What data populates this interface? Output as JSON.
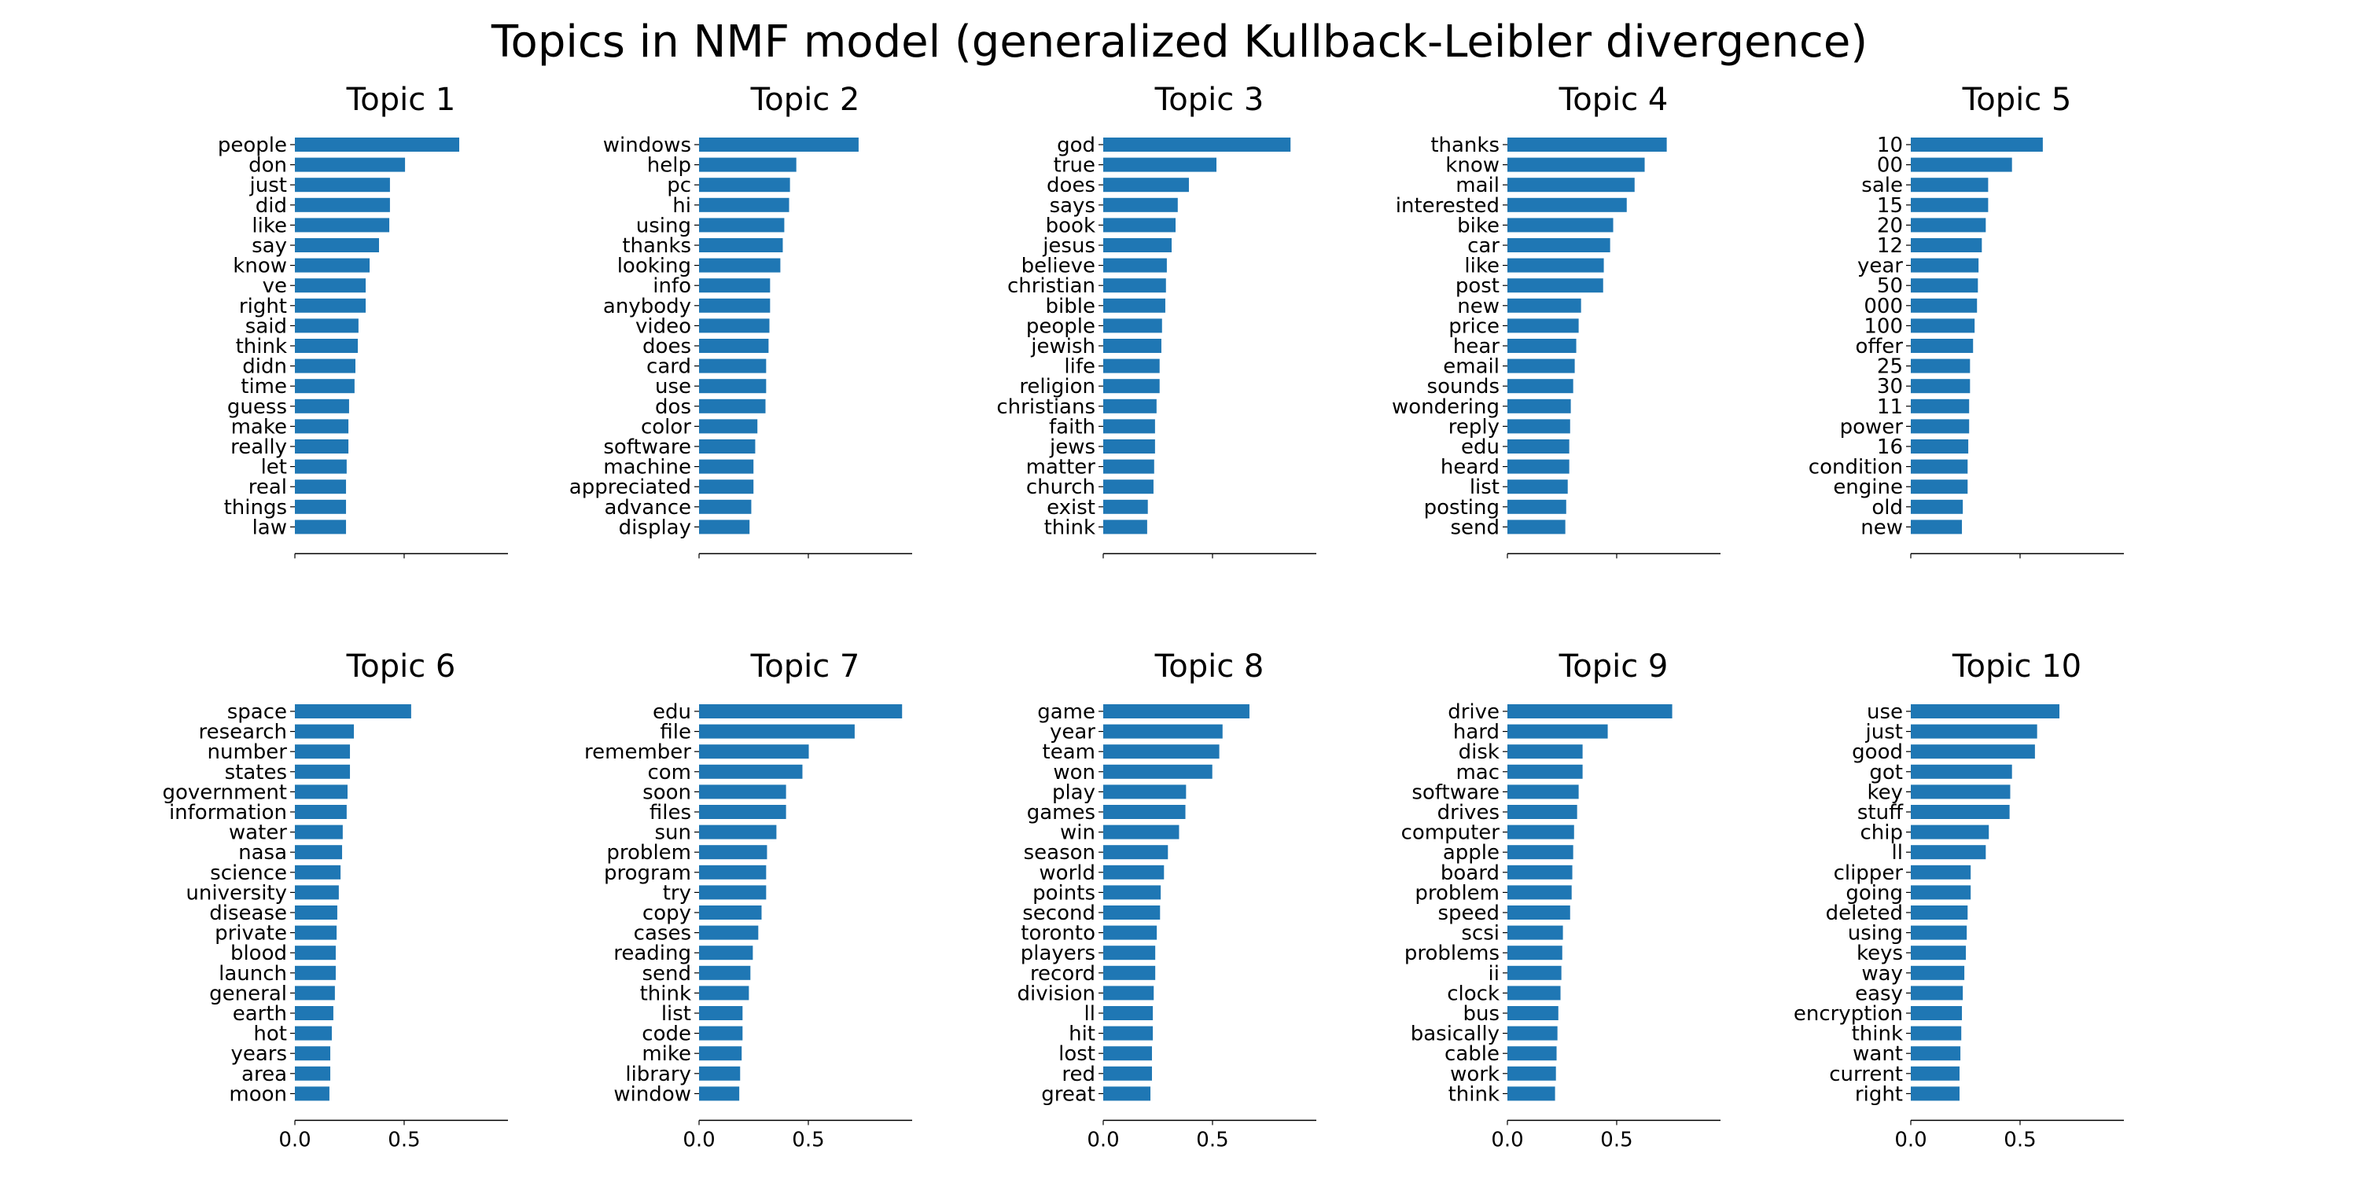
{
  "chart_data": {
    "type": "bar",
    "orientation": "horizontal",
    "title": "Topics in NMF model (generalized Kullback-Leibler divergence)",
    "bar_color": "#1f77b4",
    "xlim": [
      0,
      0.975
    ],
    "xticks": [
      "0.0",
      "0.5"
    ],
    "xtick_values": [
      0,
      0.5
    ],
    "xtick_labels_visible_on": "bottom-row",
    "grid": false,
    "panels": [
      {
        "title": "Topic 1",
        "categories": [
          "people",
          "don",
          "just",
          "did",
          "like",
          "say",
          "know",
          "ve",
          "right",
          "said",
          "think",
          "didn",
          "time",
          "guess",
          "make",
          "really",
          "let",
          "real",
          "things",
          "law"
        ],
        "values": [
          0.752,
          0.504,
          0.435,
          0.435,
          0.432,
          0.385,
          0.342,
          0.324,
          0.324,
          0.291,
          0.288,
          0.277,
          0.273,
          0.248,
          0.245,
          0.245,
          0.237,
          0.234,
          0.234,
          0.234
        ]
      },
      {
        "title": "Topic 2",
        "categories": [
          "windows",
          "help",
          "pc",
          "hi",
          "using",
          "thanks",
          "looking",
          "info",
          "anybody",
          "video",
          "does",
          "card",
          "use",
          "dos",
          "color",
          "software",
          "machine",
          "appreciated",
          "advance",
          "display"
        ],
        "values": [
          0.73,
          0.445,
          0.416,
          0.412,
          0.39,
          0.383,
          0.372,
          0.325,
          0.325,
          0.322,
          0.318,
          0.307,
          0.307,
          0.304,
          0.267,
          0.257,
          0.249,
          0.249,
          0.239,
          0.231
        ]
      },
      {
        "title": "Topic 3",
        "categories": [
          "god",
          "true",
          "does",
          "says",
          "book",
          "jesus",
          "believe",
          "christian",
          "bible",
          "people",
          "jewish",
          "life",
          "religion",
          "christians",
          "faith",
          "jews",
          "matter",
          "church",
          "exist",
          "think"
        ],
        "values": [
          0.857,
          0.518,
          0.392,
          0.341,
          0.331,
          0.313,
          0.291,
          0.287,
          0.284,
          0.269,
          0.266,
          0.258,
          0.258,
          0.244,
          0.237,
          0.237,
          0.233,
          0.23,
          0.204,
          0.201
        ]
      },
      {
        "title": "Topic 4",
        "categories": [
          "thanks",
          "know",
          "mail",
          "interested",
          "bike",
          "car",
          "like",
          "post",
          "new",
          "price",
          "hear",
          "email",
          "sounds",
          "wondering",
          "reply",
          "edu",
          "heard",
          "list",
          "posting",
          "send"
        ],
        "values": [
          0.729,
          0.628,
          0.582,
          0.546,
          0.484,
          0.47,
          0.441,
          0.438,
          0.337,
          0.326,
          0.315,
          0.308,
          0.301,
          0.29,
          0.287,
          0.283,
          0.283,
          0.276,
          0.269,
          0.265
        ]
      },
      {
        "title": "Topic 5",
        "categories": [
          "10",
          "00",
          "sale",
          "15",
          "20",
          "12",
          "year",
          "50",
          "000",
          "100",
          "offer",
          "25",
          "30",
          "11",
          "power",
          "16",
          "condition",
          "engine",
          "old",
          "new"
        ],
        "values": [
          0.604,
          0.463,
          0.354,
          0.354,
          0.343,
          0.325,
          0.31,
          0.307,
          0.303,
          0.292,
          0.285,
          0.271,
          0.271,
          0.267,
          0.267,
          0.263,
          0.26,
          0.26,
          0.238,
          0.234
        ]
      },
      {
        "title": "Topic 6",
        "categories": [
          "space",
          "research",
          "number",
          "states",
          "government",
          "information",
          "water",
          "nasa",
          "science",
          "university",
          "disease",
          "private",
          "blood",
          "launch",
          "general",
          "earth",
          "hot",
          "years",
          "area",
          "moon"
        ],
        "values": [
          0.532,
          0.27,
          0.252,
          0.252,
          0.241,
          0.237,
          0.219,
          0.216,
          0.209,
          0.201,
          0.194,
          0.191,
          0.187,
          0.187,
          0.183,
          0.176,
          0.169,
          0.162,
          0.162,
          0.158
        ]
      },
      {
        "title": "Topic 7",
        "categories": [
          "edu",
          "file",
          "remember",
          "com",
          "soon",
          "files",
          "sun",
          "problem",
          "program",
          "try",
          "copy",
          "cases",
          "reading",
          "send",
          "think",
          "list",
          "code",
          "mike",
          "library",
          "window"
        ],
        "values": [
          0.929,
          0.712,
          0.502,
          0.473,
          0.398,
          0.398,
          0.354,
          0.311,
          0.307,
          0.307,
          0.286,
          0.271,
          0.246,
          0.235,
          0.228,
          0.199,
          0.199,
          0.195,
          0.188,
          0.184
        ]
      },
      {
        "title": "Topic 8",
        "categories": [
          "game",
          "year",
          "team",
          "won",
          "play",
          "games",
          "win",
          "season",
          "world",
          "points",
          "second",
          "toronto",
          "players",
          "record",
          "division",
          "ll",
          "hit",
          "lost",
          "red",
          "great"
        ],
        "values": [
          0.669,
          0.546,
          0.531,
          0.499,
          0.379,
          0.376,
          0.347,
          0.296,
          0.278,
          0.263,
          0.26,
          0.245,
          0.238,
          0.238,
          0.231,
          0.227,
          0.227,
          0.223,
          0.223,
          0.216
        ]
      },
      {
        "title": "Topic 9",
        "categories": [
          "drive",
          "hard",
          "disk",
          "mac",
          "software",
          "drives",
          "computer",
          "apple",
          "board",
          "problem",
          "speed",
          "scsi",
          "problems",
          "ii",
          "clock",
          "bus",
          "basically",
          "cable",
          "work",
          "think"
        ],
        "values": [
          0.754,
          0.459,
          0.344,
          0.344,
          0.326,
          0.319,
          0.305,
          0.301,
          0.297,
          0.294,
          0.287,
          0.254,
          0.251,
          0.247,
          0.243,
          0.233,
          0.229,
          0.225,
          0.222,
          0.218
        ]
      },
      {
        "title": "Topic 10",
        "categories": [
          "use",
          "just",
          "good",
          "got",
          "key",
          "stuff",
          "chip",
          "ll",
          "clipper",
          "going",
          "deleted",
          "using",
          "keys",
          "way",
          "easy",
          "encryption",
          "think",
          "want",
          "current",
          "right"
        ],
        "values": [
          0.68,
          0.578,
          0.568,
          0.463,
          0.455,
          0.452,
          0.357,
          0.343,
          0.274,
          0.274,
          0.26,
          0.256,
          0.252,
          0.245,
          0.238,
          0.234,
          0.231,
          0.227,
          0.223,
          0.223
        ]
      }
    ]
  }
}
